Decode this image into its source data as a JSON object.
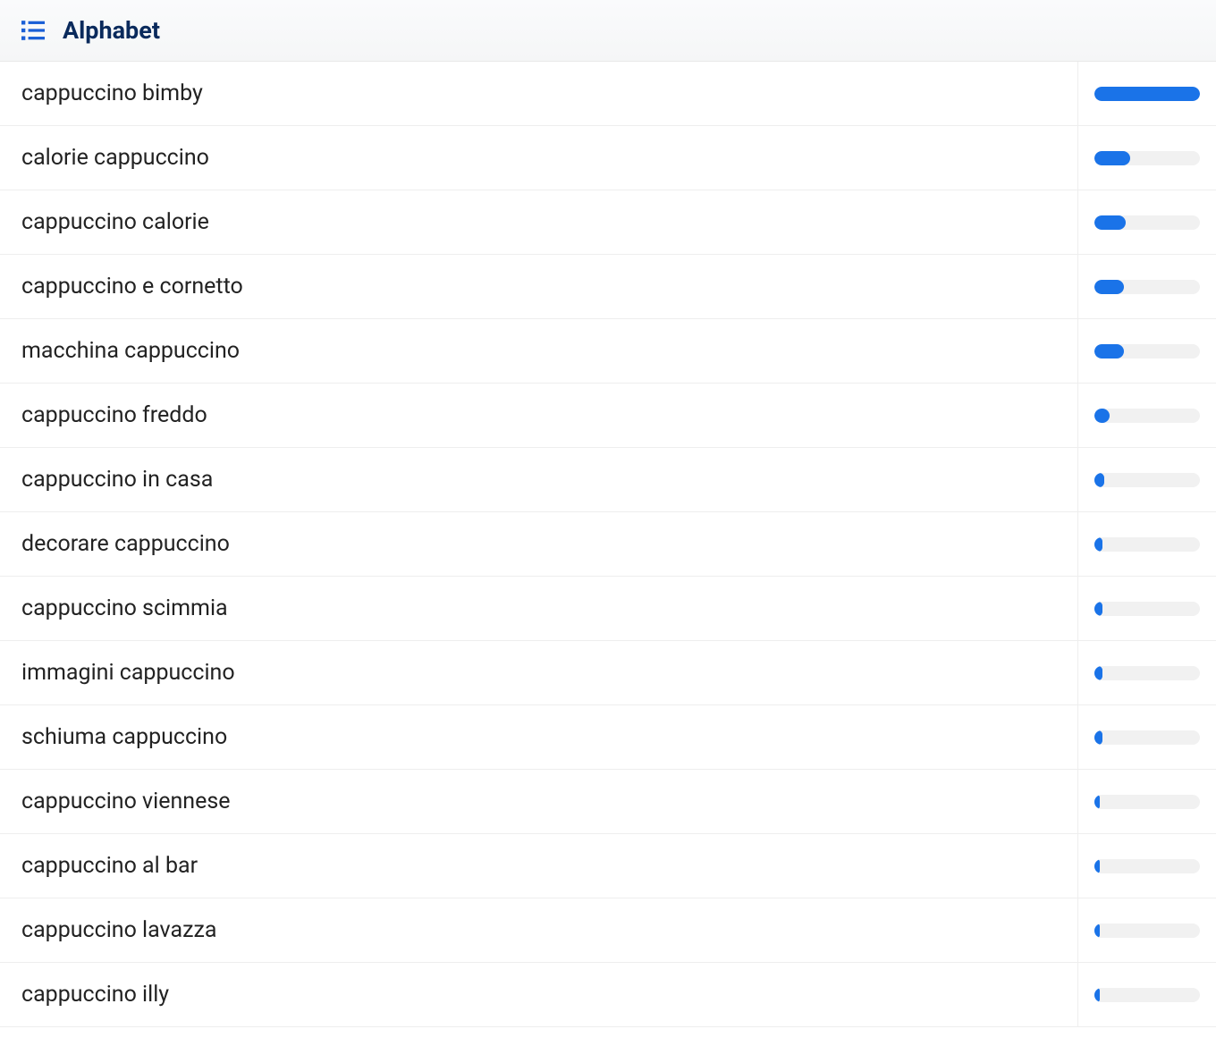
{
  "header": {
    "title": "Alphabet"
  },
  "chart_data": {
    "type": "bar",
    "title": "Alphabet",
    "xlabel": "",
    "ylabel": "",
    "ylim": [
      0,
      100
    ],
    "categories": [
      "cappuccino bimby",
      "calorie cappuccino",
      "cappuccino calorie",
      "cappuccino e cornetto",
      "macchina cappuccino",
      "cappuccino freddo",
      "cappuccino in casa",
      "decorare cappuccino",
      "cappuccino scimmia",
      "immagini cappuccino",
      "schiuma cappuccino",
      "cappuccino viennese",
      "cappuccino al bar",
      "cappuccino lavazza",
      "cappuccino illy"
    ],
    "values": [
      100,
      34,
      30,
      28,
      28,
      14,
      9,
      8,
      8,
      8,
      8,
      5,
      5,
      5,
      5
    ]
  },
  "colors": {
    "accent": "#1a73e8",
    "header_text": "#0a2a5c"
  }
}
